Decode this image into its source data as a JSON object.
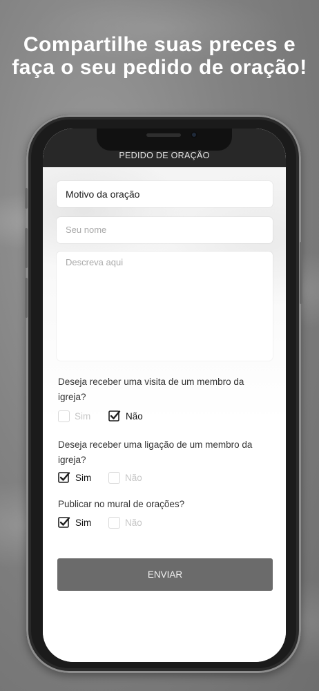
{
  "headline": "Compartilhe suas preces e faça o seu pedido de oração!",
  "app": {
    "title": "PEDIDO DE ORAÇÃO"
  },
  "form": {
    "motivo_value": "Motivo da oração",
    "nome_placeholder": "Seu nome",
    "descricao_placeholder": "Descreva aqui",
    "questions": [
      {
        "text": "Deseja receber uma visita de um membro da igreja?",
        "options": [
          {
            "label": "Sim",
            "checked": false
          },
          {
            "label": "Não",
            "checked": true
          }
        ]
      },
      {
        "text": "Deseja receber uma ligação de um membro da igreja?",
        "options": [
          {
            "label": "Sim",
            "checked": true
          },
          {
            "label": "Não",
            "checked": false
          }
        ]
      },
      {
        "text": "Publicar no mural de orações?",
        "options": [
          {
            "label": "Sim",
            "checked": true
          },
          {
            "label": "Não",
            "checked": false
          }
        ]
      }
    ],
    "submit_label": "ENVIAR"
  }
}
